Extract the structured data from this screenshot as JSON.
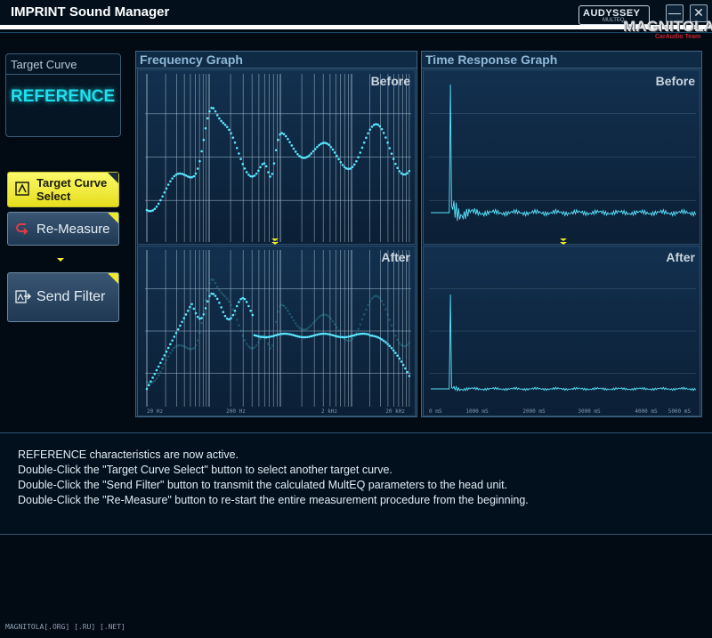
{
  "app": {
    "title": "IMPRINT Sound Manager",
    "badge": "AUDYSSEY",
    "badge_sub": "MULTEQ",
    "logo": "MAGNITOLA",
    "logo_sub": "CarAudio Team"
  },
  "sidebar": {
    "target_curve_label": "Target Curve",
    "target_curve_value": "REFERENCE",
    "buttons": {
      "target_curve_select": [
        "Target Curve",
        "Select"
      ],
      "re_measure": "Re-Measure",
      "send_filter": "Send Filter"
    }
  },
  "frequency_graph": {
    "title": "Frequency Graph",
    "before_label": "Before",
    "after_label": "After",
    "x_ticks": [
      "20 Hz",
      "200 Hz",
      "2 kHz",
      "20 kHz"
    ]
  },
  "time_graph": {
    "title": "Time Response Graph",
    "before_label": "Before",
    "after_label": "After",
    "x_ticks": [
      "0 mS",
      "1000 mS",
      "2000 mS",
      "3000 mS",
      "4000 mS",
      "5000 mS"
    ]
  },
  "status": {
    "lines": [
      "REFERENCE characteristics are now active.",
      "Double-Click the \"Target Curve Select\" button to select another target curve.",
      "Double-Click the \"Send Filter\" button to transmit the calculated MultEQ parameters to the head unit.",
      "Double-Click the \"Re-Measure\" button to re-start the entire measurement procedure from the beginning."
    ]
  },
  "footer": "MAGNITOLA[.ORG] [.RU] [.NET]",
  "colors": {
    "accent": "#1ee0ee",
    "trace": "#5ae8ff",
    "button_yellow": "#f0ea2a",
    "panel": "#0b2238"
  }
}
